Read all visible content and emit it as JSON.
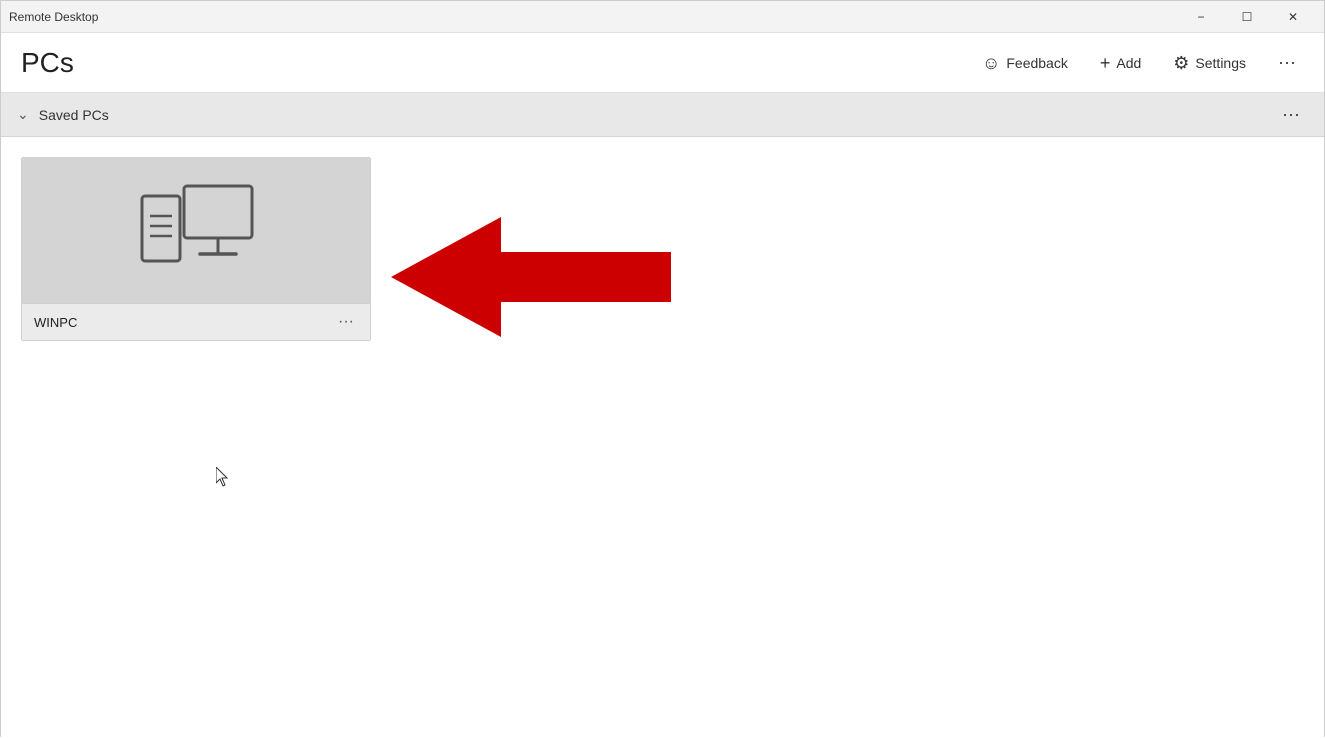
{
  "titleBar": {
    "appName": "Remote Desktop",
    "minimizeLabel": "−",
    "maximizeLabel": "☐",
    "closeLabel": "✕"
  },
  "header": {
    "title": "PCs",
    "feedbackLabel": "Feedback",
    "addLabel": "Add",
    "settingsLabel": "Settings",
    "moreLabel": "···"
  },
  "savedPcsBar": {
    "label": "Saved PCs",
    "moreLabel": "···"
  },
  "pcCard": {
    "name": "WINPC",
    "moreLabel": "···"
  }
}
